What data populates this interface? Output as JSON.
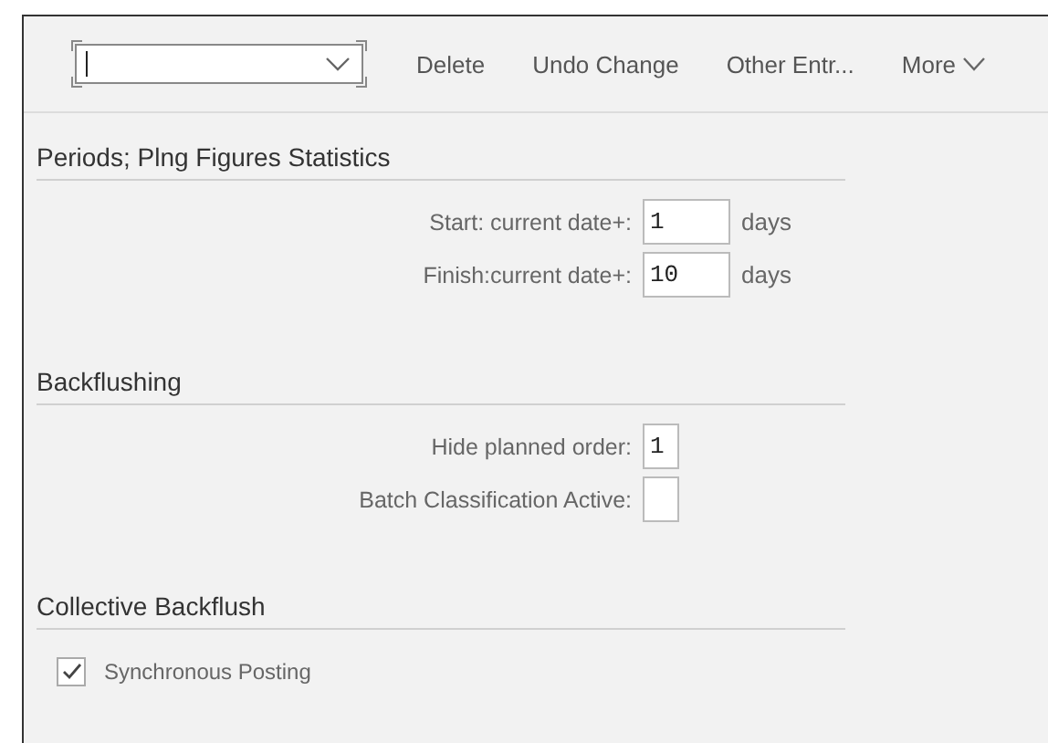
{
  "toolbar": {
    "combobox": {
      "focused": true
    },
    "buttons": [
      {
        "label": "Delete",
        "kind": "plain"
      },
      {
        "label": "Undo Change",
        "kind": "plain"
      },
      {
        "label": "Other Entr...",
        "kind": "plain"
      },
      {
        "label": "More",
        "kind": "menu"
      }
    ]
  },
  "sections": [
    {
      "title": "Periods; Plng Figures Statistics",
      "fields": [
        {
          "kind": "number",
          "label": "Start: current date+:",
          "value": "1",
          "unit": "days"
        },
        {
          "kind": "number",
          "label": "Finish:current date+:",
          "value": "10",
          "unit": "days"
        }
      ]
    },
    {
      "title": "Backflushing",
      "fields": [
        {
          "kind": "indicator",
          "label": "Hide planned order:",
          "value": "1"
        },
        {
          "kind": "indicator",
          "label": "Batch Classification Active:"
        }
      ]
    },
    {
      "title": "Collective Backflush",
      "fields": [
        {
          "kind": "checkbox",
          "label": "Synchronous Posting",
          "checked": true
        }
      ]
    }
  ]
}
